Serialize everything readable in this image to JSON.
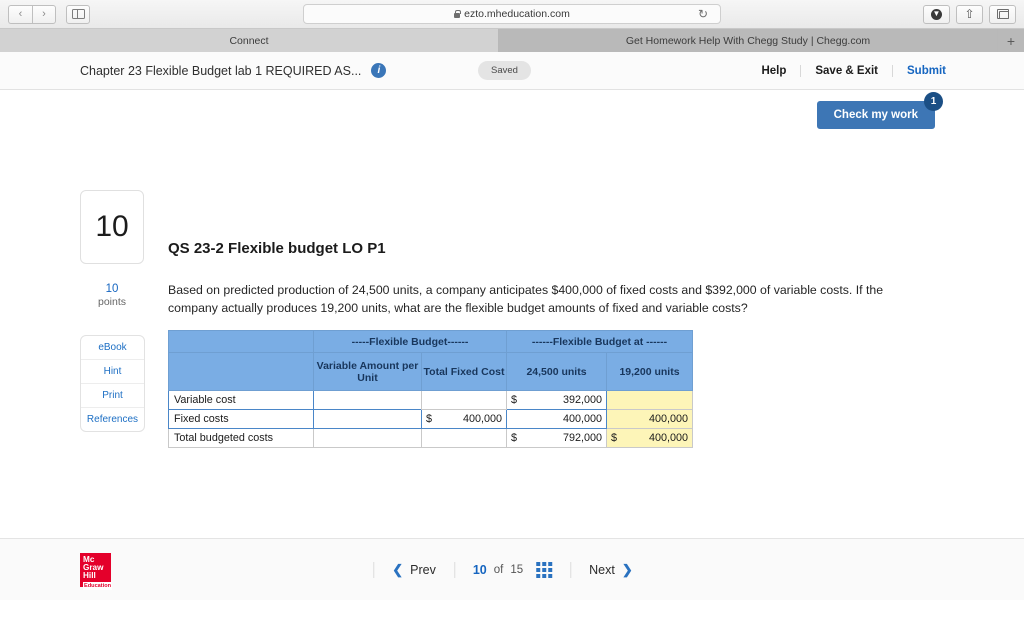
{
  "browser": {
    "url": "ezto.mheducation.com",
    "back_icon": "chevron-left-icon",
    "forward_icon": "chevron-right-icon",
    "sidebar_icon": "sidebar-toggle-icon",
    "reload_icon": "reload-icon",
    "download_icon": "download-icon",
    "share_icon": "share-icon",
    "tabs_icon": "show-tabs-icon",
    "new_tab_label": "+",
    "tabs": [
      {
        "label": "Connect",
        "active": true
      },
      {
        "label": "Get Homework Help With Chegg Study | Chegg.com",
        "active": false
      }
    ]
  },
  "header": {
    "assignment_title": "Chapter 23 Flexible Budget lab 1 REQUIRED AS...",
    "info_icon": "info-icon",
    "status_pill": "Saved",
    "help_label": "Help",
    "save_exit_label": "Save & Exit",
    "submit_label": "Submit"
  },
  "check_work": {
    "label": "Check my work",
    "badge": "1"
  },
  "question": {
    "points_value": "10",
    "points_number": "10",
    "points_word": "points",
    "title": "QS 23-2 Flexible budget LO P1",
    "body": "Based on predicted production of 24,500 units, a company anticipates $400,000 of fixed costs and $392,000 of variable costs. If the company actually produces 19,200 units, what are the flexible budget amounts of fixed and variable costs?"
  },
  "side_links": [
    {
      "label": "eBook"
    },
    {
      "label": "Hint"
    },
    {
      "label": "Print"
    },
    {
      "label": "References"
    }
  ],
  "table": {
    "group_headers": {
      "blank": "",
      "flexible_budget": "-----Flexible Budget------",
      "flexible_budget_at": "------Flexible Budget at ------"
    },
    "column_headers": {
      "blank": "",
      "variable_amount_per_unit": "Variable Amount per Unit",
      "total_fixed_cost": "Total Fixed Cost",
      "units_24500": "24,500 units",
      "units_19200": "19,200 units"
    },
    "rows": [
      {
        "label": "Variable cost",
        "variable_amount": "",
        "total_fixed_cost": "",
        "units_24500_currency": "$",
        "units_24500_value": "392,000",
        "units_19200_currency": "",
        "units_19200_value": ""
      },
      {
        "label": "Fixed costs",
        "variable_amount": "",
        "total_fixed_currency": "$",
        "total_fixed_value": "400,000",
        "units_24500_currency": "",
        "units_24500_value": "400,000",
        "units_19200_currency": "",
        "units_19200_value": "400,000"
      },
      {
        "label": "Total budgeted costs",
        "variable_amount": "",
        "total_fixed_cost": "",
        "units_24500_currency": "$",
        "units_24500_value": "792,000",
        "units_19200_currency": "$",
        "units_19200_value": "400,000"
      }
    ]
  },
  "footer": {
    "logo_line1": "Mc",
    "logo_line2": "Graw",
    "logo_line3": "Hill",
    "logo_line4": "Education",
    "prev_label": "Prev",
    "next_label": "Next",
    "current_page": "10",
    "of_label": "of",
    "total_pages": "15",
    "grid_icon": "grid-view-icon"
  },
  "colors": {
    "accent_blue": "#1565c0",
    "table_header_blue": "#7aade4",
    "highlight_yellow": "#fdf5b8",
    "button_blue": "#3d76b5",
    "logo_red": "#e4002b"
  }
}
